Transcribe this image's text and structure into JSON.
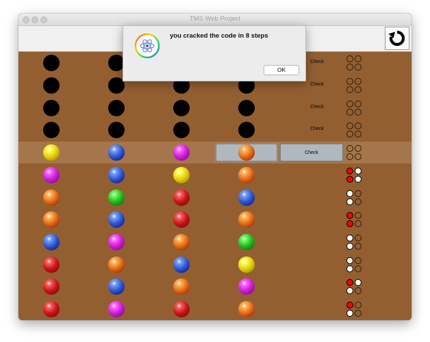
{
  "window": {
    "title": "TMS Web Project"
  },
  "dialog": {
    "message": "you cracked the code in 8 steps",
    "ok_label": "OK"
  },
  "colors": {
    "yellow": "#e6cf10",
    "blue": "#2f59d0",
    "magenta": "#cc1fd4",
    "orange": "#e36e16",
    "green": "#26b81e",
    "red": "#c7171a"
  },
  "rows": [
    {
      "pegs": [
        "black",
        "black",
        "black",
        "black"
      ],
      "check": "Check",
      "feedback": [
        "empty",
        "empty",
        "empty",
        "empty"
      ]
    },
    {
      "pegs": [
        "black",
        "black",
        "black",
        "black"
      ],
      "check": "Check",
      "feedback": [
        "empty",
        "empty",
        "empty",
        "empty"
      ]
    },
    {
      "pegs": [
        "black",
        "black",
        "black",
        "black"
      ],
      "check": "Check",
      "feedback": [
        "empty",
        "empty",
        "empty",
        "empty"
      ]
    },
    {
      "pegs": [
        "black",
        "black",
        "black",
        "black"
      ],
      "check": "Check",
      "feedback": [
        "empty",
        "empty",
        "empty",
        "empty"
      ]
    },
    {
      "pegs": [
        "yellow",
        "blue",
        "magenta",
        "orange"
      ],
      "check": "Check",
      "feedback": [
        "empty",
        "empty",
        "empty",
        "empty"
      ],
      "active": true
    },
    {
      "pegs": [
        "magenta",
        "blue",
        "yellow",
        "orange"
      ],
      "feedback": [
        "red",
        "white",
        "red",
        "white"
      ]
    },
    {
      "pegs": [
        "orange",
        "green",
        "red",
        "blue"
      ],
      "feedback": [
        "white",
        "empty",
        "white",
        "empty"
      ]
    },
    {
      "pegs": [
        "orange",
        "blue",
        "red",
        "orange"
      ],
      "feedback": [
        "red",
        "empty",
        "red",
        "empty"
      ]
    },
    {
      "pegs": [
        "blue",
        "magenta",
        "orange",
        "green"
      ],
      "feedback": [
        "white",
        "empty",
        "white",
        "empty"
      ]
    },
    {
      "pegs": [
        "red",
        "orange",
        "blue",
        "yellow"
      ],
      "feedback": [
        "white",
        "empty",
        "white",
        "empty"
      ]
    },
    {
      "pegs": [
        "red",
        "blue",
        "orange",
        "magenta"
      ],
      "feedback": [
        "red",
        "white",
        "white",
        "empty"
      ]
    },
    {
      "pegs": [
        "red",
        "magenta",
        "red",
        "orange"
      ],
      "feedback": [
        "red",
        "empty",
        "white",
        "empty"
      ]
    }
  ]
}
